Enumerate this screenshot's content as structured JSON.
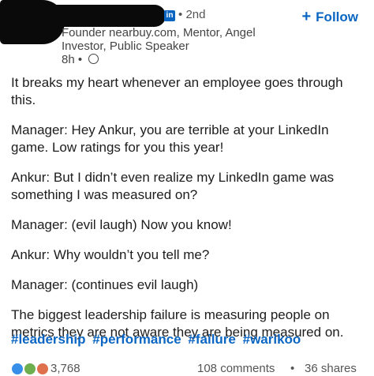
{
  "header": {
    "degree": "2nd",
    "linkedin_badge": "in",
    "follow_label": "Follow",
    "follow_icon": "+",
    "headline": "Founder nearbuy.com, Mentor, Angel Investor, Public Speaker",
    "time": "8h",
    "separator": "•"
  },
  "post": {
    "paragraphs": [
      "It breaks my heart whenever an employee goes through this.",
      "Manager: Hey Ankur, you are terrible at your LinkedIn game. Low ratings for you this year!",
      "Ankur: But I didn’t even realize my LinkedIn game was something I was measured on?",
      "Manager: (evil laugh) Now you know!",
      "Ankur: Why wouldn’t you tell me?",
      "Manager: (continues evil laugh)",
      "The biggest leadership failure is measuring people on metrics they are not aware they are being measured on."
    ],
    "hashtags": [
      "#leadership",
      "#performance",
      "#failure",
      "#warikoo"
    ]
  },
  "footer": {
    "reaction_count": "3,768",
    "comments": "108 comments",
    "separator": "•",
    "shares": "36 shares"
  },
  "colors": {
    "linkedin_blue": "#0a66c2",
    "text": "#1d1d1d",
    "secondary_text": "#555555"
  }
}
